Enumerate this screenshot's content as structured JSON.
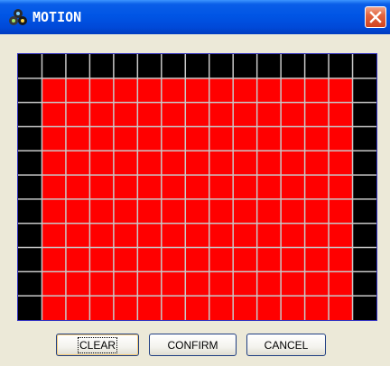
{
  "window": {
    "title": "MOTION",
    "app_icon": "app-icon",
    "close_icon": "close-icon"
  },
  "motion_grid": {
    "columns": 15,
    "rows": 11,
    "inactive_color": "#000000",
    "active_color": "#ff0000",
    "gridline_color": "#c8c8c8",
    "border_color": "#3030c0",
    "active_region": {
      "first_column": 1,
      "last_column": 13,
      "first_row": 1,
      "last_row": 10
    }
  },
  "buttons": {
    "clear_label": "CLEAR",
    "confirm_label": "CONFIRM",
    "cancel_label": "CANCEL"
  }
}
